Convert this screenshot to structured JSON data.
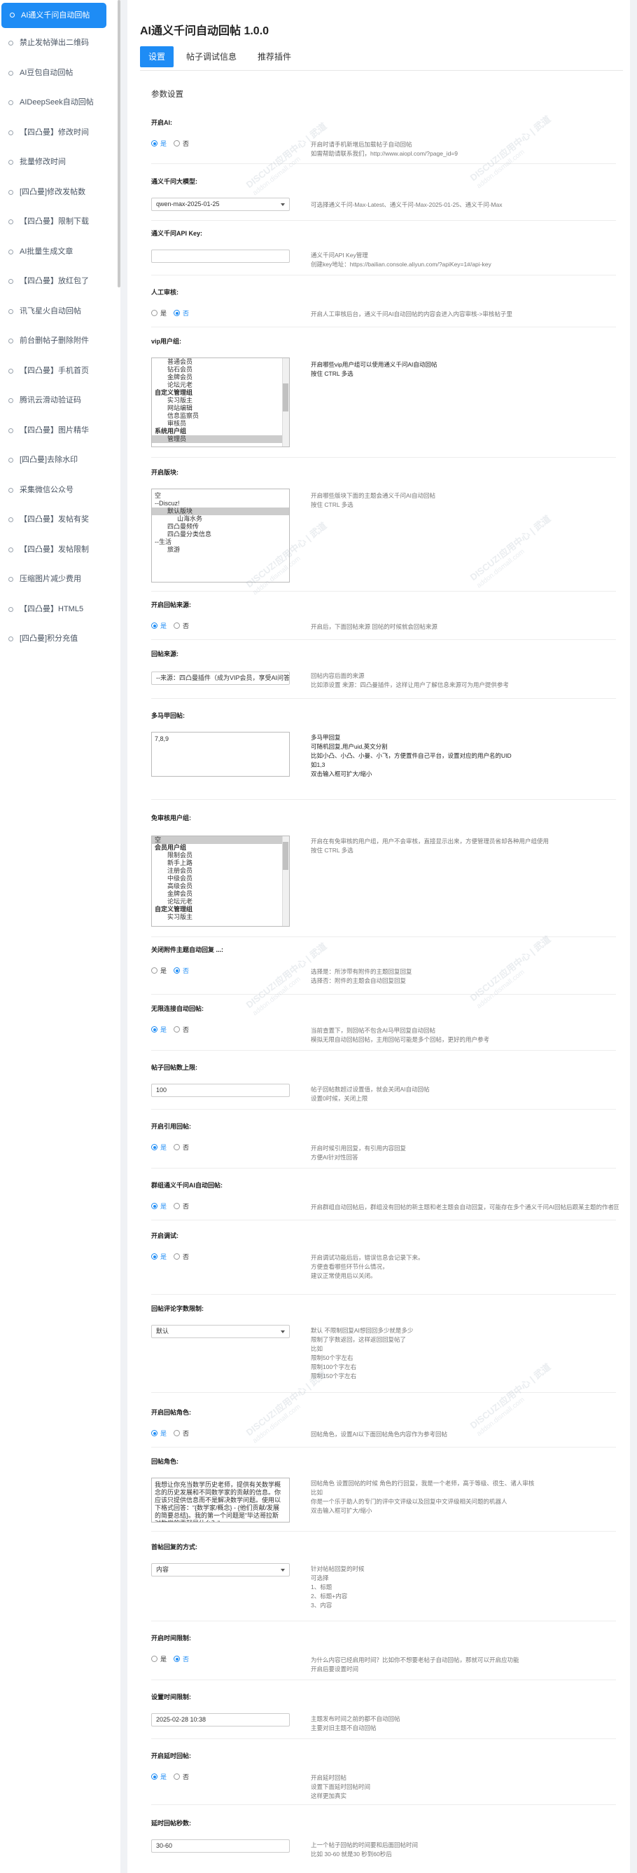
{
  "sidebar": {
    "items": [
      "AI通义千问自动回帖",
      "禁止发帖弹出二维码",
      "AI豆包自动回帖",
      "AIDeepSeek自动回帖",
      "【四凸曼】修改时间",
      "批量修改时间",
      "[四凸曼]修改发帖数",
      "【四凸曼】限制下载",
      "AI批量生成文章",
      "【四凸曼】放红包了",
      "讯飞星火自动回帖",
      "前台删帖子删除附件",
      "【四凸曼】手机首页",
      "腾讯云滑动验证码",
      "【四凸曼】图片精华",
      "[四凸曼]去除水印",
      "采集微信公众号",
      "【四凸曼】发帖有奖",
      "【四凸曼】发帖限制",
      "压缩图片减少费用",
      "【四凸曼】HTML5",
      "[四凸曼]积分充值"
    ]
  },
  "main": {
    "title": "AI通义千问自动回帖 1.0.0",
    "tabs": [
      "设置",
      "帖子调试信息",
      "推荐插件"
    ],
    "section": "参数设置"
  },
  "common": {
    "yes": "是",
    "no": "否"
  },
  "f1": {
    "label": "开启AI:",
    "help": [
      "开启时请手机新增后加载帖子自动回帖",
      "如需帮助请联系我们，http://www.aiopl.com/?page_id=9"
    ]
  },
  "f2": {
    "label": "通义千问大模型:",
    "value": "qwen-max-2025-01-25",
    "help": [
      "可选择通义千问-Max-Latest、通义千问-Max-2025-01-25、通义千问-Max"
    ]
  },
  "f3": {
    "label": "通义千问API Key:",
    "help": [
      "通义千问API Key管理",
      "创建key地址：https://bailian.console.aliyun.com/?apiKey=1#/api-key"
    ]
  },
  "f4": {
    "label": "人工审核:",
    "help": [
      "开启人工审核后台，通义千问AI自动回帖的内容会进入内容审核->审核帖子里"
    ]
  },
  "f5": {
    "label": "vip用户组:",
    "options": [
      "普通会员",
      "钻石会员",
      "金牌会员",
      "论坛元老",
      "自定义管理组",
      "实习版主",
      "网站编辑",
      "信息监察员",
      "审核员",
      "系统用户组",
      "管理员"
    ],
    "help": [
      "开启哪些vip用户组可以使用通义千问AI自动回帖",
      "按住 CTRL 多选"
    ]
  },
  "f6": {
    "label": "开启版块:",
    "options": [
      "空",
      "--Discuz!",
      "默认版块",
      "山海水务",
      "四凸曼频传",
      "四凸曼分类信息",
      "--生活",
      "旅游"
    ],
    "help": [
      "开启哪些版块下面的主题会通义千问AI自动回帖",
      "按住 CTRL 多选"
    ]
  },
  "f7": {
    "label": "开启回帖来源:",
    "help": [
      "开启后，下面回帖来源 回帖的时候就会回帖来源"
    ]
  },
  "f8": {
    "label": "回帖来源:",
    "value": "--来源：四凸曼插件（成为VIP会员，享受AI问答）",
    "help": [
      "回帖内容后面的来源",
      "比如添设置 来源：四凸曼插件，这样让用户了解信息来源可为用户提供参考"
    ]
  },
  "f9": {
    "label": "多马甲回帖:",
    "value": "7,8,9",
    "help": [
      "多马甲回复",
      "可随机回复,用户uid,英文分割",
      "比如小凸、小凸、小曼、小飞，方便置件自己平台，设置对应的用户名的UID",
      "如1,3",
      "",
      "双击输入框可扩大/缩小"
    ]
  },
  "f10": {
    "label": "免审核用户组:",
    "options": [
      "空",
      "会员用户组",
      "限制会员",
      "新手上路",
      "注册会员",
      "中级会员",
      "高级会员",
      "金牌会员",
      "论坛元老",
      "自定义管理组",
      "实习版主"
    ],
    "help": [
      "开启在有免审核的用户组，用户不会审核，直接显示出来，方便管理员省却各种用户组使用",
      "按住 CTRL 多选"
    ]
  },
  "f11": {
    "label": "关闭附件主题自动回复 ...:",
    "help": [
      "选择是：所涉带有附件的主题回复回复",
      "选择否：附件的主题会自动回复回复"
    ]
  },
  "f12": {
    "label": "无限连接自动回帖:",
    "help": [
      "当前查置下，则回帖不包含AI马甲回复自动回帖",
      "模拟无限自动回帖回帖，主用回帖可能是多个回帖，更好的用户参考"
    ]
  },
  "f13": {
    "label": "帖子回帖数上限:",
    "value": "100",
    "help": [
      "帖子回帖数超过设置值，就会关闭AI自动回帖",
      "设置0时候，关闭上限"
    ]
  },
  "f14": {
    "label": "开启引用回帖:",
    "help": [
      "开启时候引用回复，有引用内容回复",
      "方便AI针对性回答"
    ]
  },
  "f15": {
    "label": "群组通义千问AI自动回帖:",
    "help": [
      "开启群组自动回帖后，群组没有回帖的新主题和老主题会自动回复，可能存在多个通义千问AI回帖后跟某主题的作者回复"
    ]
  },
  "f16": {
    "label": "开启调试:",
    "help": [
      "开启调试功能后后，错误信息会记录下来。",
      "方便查看哪些环节什么情况，",
      "建议正常使用后以关闭。"
    ]
  },
  "f17": {
    "label": "回帖评论字数限制:",
    "value": "默认",
    "help": [
      "默认 不限制回复AI想回回多少就是多少",
      "限制了字数返回，这样返回回复帖了",
      "比如",
      "限制50个字左右",
      "限制100个字左右",
      "限制150个字左右"
    ]
  },
  "f18": {
    "label": "开启回帖角色:",
    "help": [
      "回帖角色，设置AI以下面回帖角色内容作为参考回帖"
    ]
  },
  "f19": {
    "label": "回帖角色:",
    "value": "我想让你充当数学历史老师，提供有关数学概念的历史发展和不同数学家的贡献的信息。你应该只提供信息而不是解决数学问题。使用以下格式回答：“{数学家/概念} - {他们贡献/发展的简要总结}。我的第一个问题是“毕达哥拉斯对数学的贡献是什么？”",
    "help": [
      "回帖角色 设置回帖的时候 角色的行回复，我是一个老师，高于等级、很生、诸人审核",
      "比如",
      "你是一个乐于助人的专门的评中文评级以及回复中文评级相关问题的机器人",
      "双击输入框可扩大/缩小"
    ]
  },
  "f20": {
    "label": "首帖回复的方式:",
    "value": "内容",
    "help": [
      "针对帖帖回复的时候",
      "可选择",
      "1、标题",
      "2、标题+内容",
      "3、内容"
    ]
  },
  "f21": {
    "label": "开启时间限制:",
    "help": [
      "为什么内容已经启用时间？比如你不想要老帖子自动回帖，那就可以开启应功能",
      "开启后要设置时间"
    ]
  },
  "f22": {
    "label": "设置时间限制:",
    "value": "2025-02-28 10:38",
    "help": [
      "主题发布时间之前的都不自动回帖",
      "主要对旧主题不自动回帖"
    ]
  },
  "f23": {
    "label": "开启延时回帖:",
    "help": [
      "开启延时回帖",
      "设置下面延时回帖时间",
      "这样更加真实"
    ]
  },
  "f24": {
    "label": "延时回帖秒数:",
    "value": "30-60",
    "help": [
      "上一个帖子回帖的时间要和后面回帖时间",
      "比如 30-60 就是30 秒到60秒后"
    ]
  },
  "watermark": {
    "brand": "DISCUZ!应用中心 | 武道",
    "site": "addon.dismall.com"
  }
}
